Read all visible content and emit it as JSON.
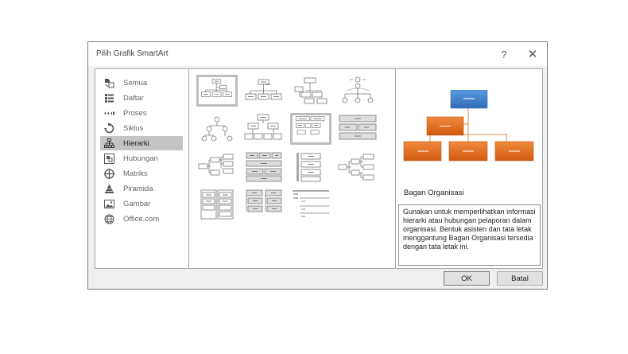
{
  "window": {
    "title": "Pilih Grafik SmartArt",
    "help_label": "?",
    "close_label": "✕"
  },
  "categories": [
    {
      "label": "Semua",
      "icon": "all-layouts-icon"
    },
    {
      "label": "Daftar",
      "icon": "list-icon"
    },
    {
      "label": "Proses",
      "icon": "process-icon"
    },
    {
      "label": "Siklus",
      "icon": "cycle-icon"
    },
    {
      "label": "Hierarki",
      "icon": "hierarchy-icon",
      "selected": true
    },
    {
      "label": "Hubungan",
      "icon": "relationship-icon"
    },
    {
      "label": "Matriks",
      "icon": "matrix-icon"
    },
    {
      "label": "Piramida",
      "icon": "pyramid-icon"
    },
    {
      "label": "Gambar",
      "icon": "picture-icon"
    },
    {
      "label": "Office.com",
      "icon": "globe-icon"
    }
  ],
  "preview": {
    "title": "Bagan Organisasi",
    "description": "Gunakan untuk memperlihatkan informasi hierarki atau hubungan pelaporan dalam organisasi. Bentuk asisten dan tata letak menggantung Bagan Organisasi tersedia dengan tata letak ini."
  },
  "buttons": {
    "ok": "OK",
    "cancel": "Batal"
  },
  "colors": {
    "preview_top": "#3a7dc6",
    "preview_boxes": "#e36a1b",
    "selection": "#c4c4c4"
  }
}
